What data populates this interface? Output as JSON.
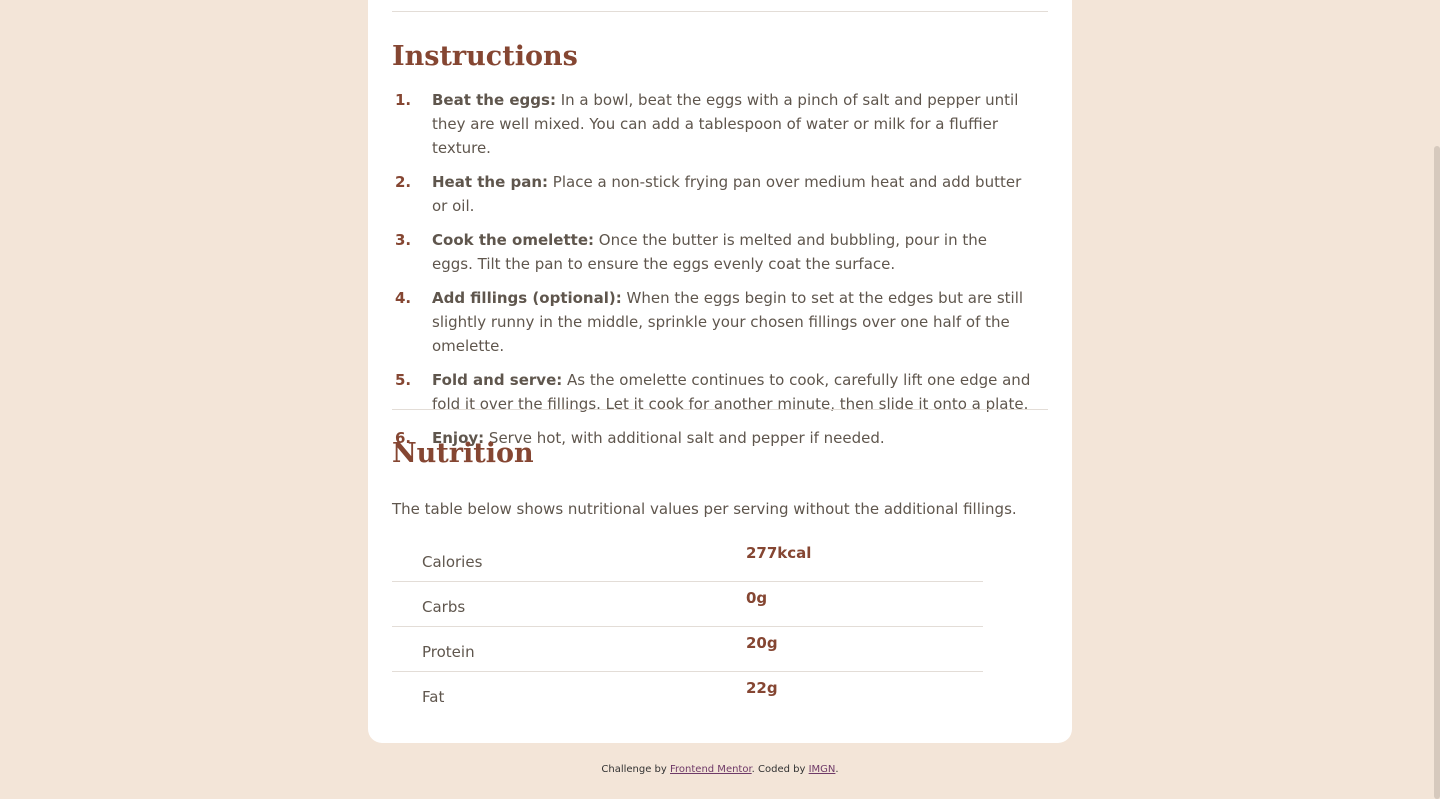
{
  "instructions": {
    "title": "Instructions",
    "steps": [
      {
        "num": "1.",
        "lead": "Beat the eggs:",
        "text": " In a bowl, beat the eggs with a pinch of salt and pepper until they are well mixed. You can add a tablespoon of water or milk for a fluffier texture."
      },
      {
        "num": "2.",
        "lead": "Heat the pan:",
        "text": " Place a non-stick frying pan over medium heat and add butter or oil."
      },
      {
        "num": "3.",
        "lead": "Cook the omelette:",
        "text": " Once the butter is melted and bubbling, pour in the eggs. Tilt the pan to ensure the eggs evenly coat the surface."
      },
      {
        "num": "4.",
        "lead": "Add fillings (optional):",
        "text": " When the eggs begin to set at the edges but are still slightly runny in the middle, sprinkle your chosen fillings over one half of the omelette."
      },
      {
        "num": "5.",
        "lead": "Fold and serve:",
        "text": " As the omelette continues to cook, carefully lift one edge and fold it over the fillings. Let it cook for another minute, then slide it onto a plate."
      },
      {
        "num": "6.",
        "lead": "Enjoy:",
        "text": " Serve hot, with additional salt and pepper if needed."
      }
    ]
  },
  "nutrition": {
    "title": "Nutrition",
    "intro": "The table below shows nutritional values per serving without the additional fillings.",
    "rows": [
      {
        "label": "Calories",
        "value": "277kcal"
      },
      {
        "label": "Carbs",
        "value": "0g"
      },
      {
        "label": "Protein",
        "value": "20g"
      },
      {
        "label": "Fat",
        "value": "22g"
      }
    ]
  },
  "footer": {
    "prefix": "Challenge by ",
    "link1": "Frontend Mentor",
    "middle": ". Coded by ",
    "link2": "IMGN",
    "suffix": "."
  },
  "colors": {
    "background": "#f3e5d8",
    "accent": "#854632",
    "text": "#5f564d"
  }
}
